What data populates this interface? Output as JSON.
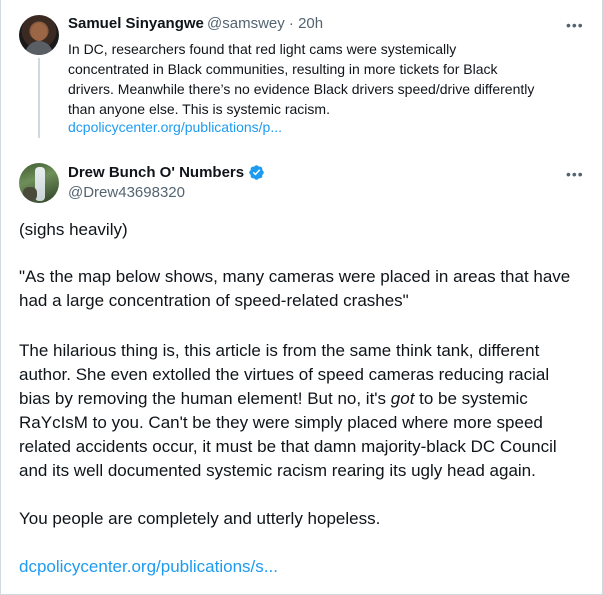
{
  "parent_tweet": {
    "display_name": "Samuel Sinyangwe",
    "handle": "@samswey",
    "separator": "·",
    "time": "20h",
    "more": "•••",
    "text_lines": [
      "In DC, researchers found that red light cams were systemically",
      "concentrated in Black communities, resulting in more tickets for Black",
      "drivers. Meanwhile there’s no evidence Black drivers speed/drive differently",
      "than anyone else. This is systemic racism."
    ],
    "link": "dcpolicycenter.org/publications/p..."
  },
  "main_tweet": {
    "display_name": "Drew Bunch O' Numbers",
    "handle": "@Drew43698320",
    "more": "•••",
    "paragraph1": "(sighs heavily)",
    "paragraph2_lines": [
      "\"As the map below shows, many cameras were placed in areas that have",
      "had a large concentration of speed-related crashes\""
    ],
    "paragraph3_lines": [
      "The hilarious thing is, this article is from the same think tank, different",
      "author. She even extolled the virtues of speed cameras reducing racial",
      "bias by removing the human element! But no, it's ",
      "got",
      " to be systemic",
      "RaYcIsM to you. Can't be they were simply placed where more speed",
      "related accidents occur, it must be that damn majority-black DC Council",
      "and its well documented systemic racism rearing its ugly head again."
    ],
    "paragraph4": "You people are completely and utterly hopeless.",
    "link": "dcpolicycenter.org/publications/s..."
  },
  "colors": {
    "text": "#0f1419",
    "secondary": "#536471",
    "link": "#1d9bf0",
    "border": "#cfd9de"
  },
  "icons": [
    "more-icon",
    "verified-badge-icon"
  ]
}
